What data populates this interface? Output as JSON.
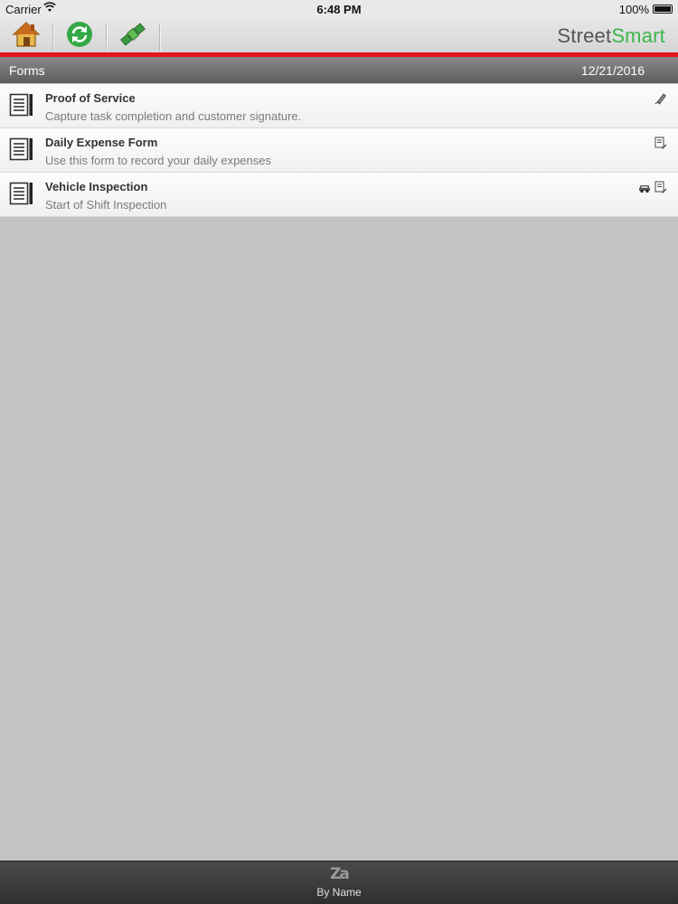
{
  "status_bar": {
    "carrier": "Carrier",
    "time": "6:48 PM",
    "battery": "100%",
    "icons": [
      "wifi-icon",
      "battery-icon"
    ]
  },
  "toolbar": {
    "tools": [
      {
        "name": "home",
        "icon": "home-icon"
      },
      {
        "name": "sync",
        "icon": "sync-icon"
      },
      {
        "name": "gps",
        "icon": "satellite-icon"
      }
    ],
    "brand": {
      "part1": "Street",
      "part2": "Smart"
    },
    "accent_color": "#e2171d",
    "brand_green": "#3cb54a"
  },
  "section": {
    "title": "Forms",
    "date": "12/21/2016"
  },
  "forms": [
    {
      "name": "Proof of Service",
      "description": "Capture task completion and customer signature.",
      "status_icons": [
        "signature-pen-icon"
      ]
    },
    {
      "name": "Daily Expense Form",
      "description": "Use this form to record your daily expenses",
      "status_icons": [
        "document-edit-icon"
      ]
    },
    {
      "name": "Vehicle Inspection",
      "description": "Start of Shift Inspection",
      "status_icons": [
        "car-icon",
        "document-edit-icon"
      ]
    }
  ],
  "bottom_bar": {
    "sort_icon_text": "Za",
    "sort_label": "By Name"
  }
}
